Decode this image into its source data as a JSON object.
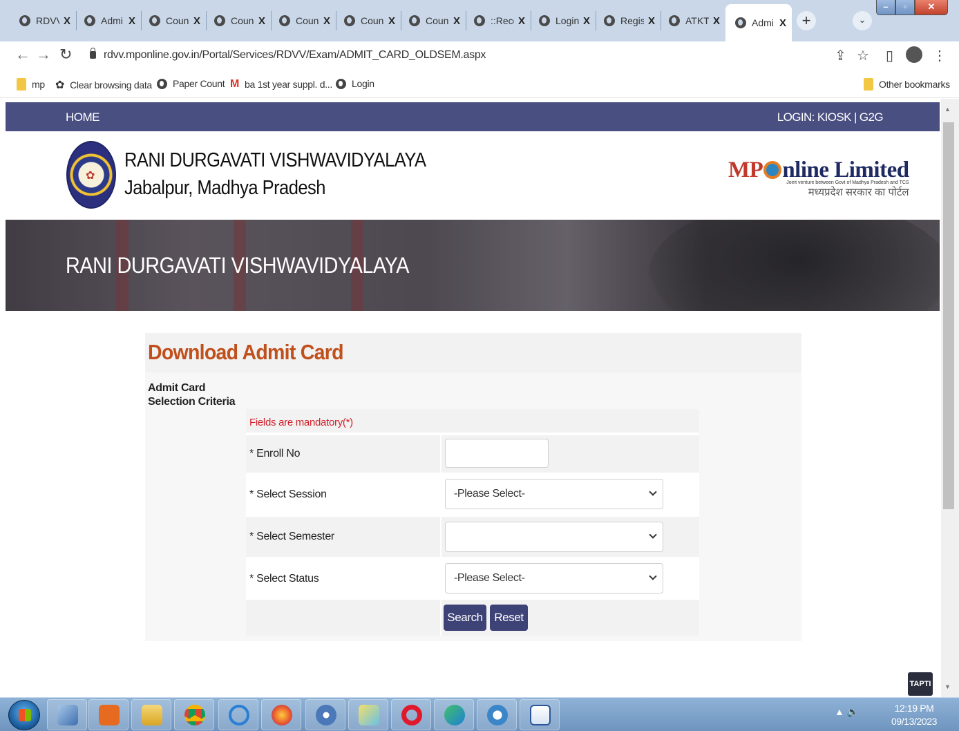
{
  "browser": {
    "tabs": [
      {
        "label": "RDVV"
      },
      {
        "label": "Admi"
      },
      {
        "label": "Coun"
      },
      {
        "label": "Coun"
      },
      {
        "label": "Coun"
      },
      {
        "label": "Coun"
      },
      {
        "label": "Coun"
      },
      {
        "label": "::Rece"
      },
      {
        "label": "Login"
      },
      {
        "label": "Regis"
      },
      {
        "label": "ATKT/"
      },
      {
        "label": "Admi"
      }
    ],
    "close_glyph": "X",
    "new_tab_glyph": "+",
    "tab_search_glyph": "⌄",
    "url": "rdvv.mponline.gov.in/Portal/Services/RDVV/Exam/ADMIT_CARD_OLDSEM.aspx",
    "bookmarks": [
      {
        "label": "mp",
        "icon": "folder-icon"
      },
      {
        "label": "Clear browsing data",
        "icon": "gear-icon"
      },
      {
        "label": "Paper Count",
        "icon": "globe-icon"
      },
      {
        "label": "ba 1st year suppl. d...",
        "icon": "gmail-icon"
      },
      {
        "label": "Login",
        "icon": "globe-icon"
      }
    ],
    "other_bookmarks": "Other bookmarks"
  },
  "site": {
    "nav_home": "HOME",
    "nav_login": "LOGIN: KIOSK | G2G",
    "university_name": "RANI DURGAVATI VISHWAVIDYALAYA",
    "university_location": "Jabalpur, Madhya Pradesh",
    "partner_brand_mp": "MP",
    "partner_brand_rest": "nline Limited",
    "partner_tagline": "Joint venture between Govt of Madhya Pradesh and TCS",
    "partner_hindi": "मध्यप्रदेश सरकार का पोर्टल",
    "banner_title": "RANI DURGAVATI VISHWAVIDYALAYA"
  },
  "form": {
    "page_title": "Download Admit Card",
    "criteria_line1": "Admit Card",
    "criteria_line2": "Selection Criteria",
    "mandatory_note": "Fields are mandatory(*)",
    "fields": {
      "enroll_label": "* Enroll No",
      "enroll_value": "",
      "session_label": "* Select Session",
      "session_value": "-Please Select-",
      "semester_label": "* Select Semester",
      "semester_value": "",
      "status_label": "* Select Status",
      "status_value": "-Please Select-"
    },
    "search_button": "Search",
    "reset_button": "Reset"
  },
  "misc": {
    "tapti_badge": "TAPTI"
  },
  "taskbar": {
    "time": "12:19 PM",
    "date": "09/13/2023"
  }
}
